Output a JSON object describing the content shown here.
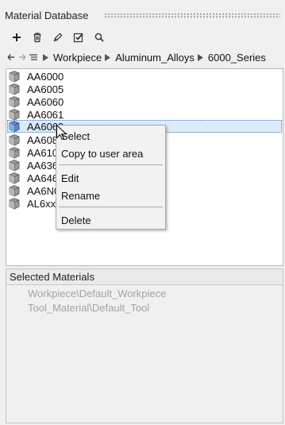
{
  "panel": {
    "title": "Material Database"
  },
  "toolbar": {
    "buttons": [
      {
        "icon": "plus-icon",
        "name": "add-button"
      },
      {
        "icon": "trash-icon",
        "name": "delete-button"
      },
      {
        "icon": "pencil-icon",
        "name": "edit-button"
      },
      {
        "icon": "checkbox-icon",
        "name": "select-button"
      },
      {
        "icon": "search-icon",
        "name": "search-button"
      }
    ]
  },
  "breadcrumb": {
    "items": [
      "Workpiece",
      "Aluminum_Alloys",
      "6000_Series"
    ]
  },
  "tree": {
    "items": [
      {
        "label": "AA6000"
      },
      {
        "label": "AA6005"
      },
      {
        "label": "AA6060"
      },
      {
        "label": "AA6061"
      },
      {
        "label": "AA6063",
        "selected": true
      },
      {
        "label": "AA608"
      },
      {
        "label": "AA610"
      },
      {
        "label": "AA636"
      },
      {
        "label": "AA646"
      },
      {
        "label": "AA6N0"
      },
      {
        "label": "AL6xx"
      }
    ]
  },
  "context_menu": {
    "items": [
      "Select",
      "Copy to user area",
      "Edit",
      "Rename",
      "Delete"
    ]
  },
  "selected_materials": {
    "header": "Selected Materials",
    "items": [
      "Workpiece\\Default_Workpiece",
      "Tool_Material\\Default_Tool"
    ]
  },
  "colors": {
    "selection": "#dcebfb",
    "cube_gray": "#8e8e8e",
    "cube_blue": "#5b88c4"
  }
}
